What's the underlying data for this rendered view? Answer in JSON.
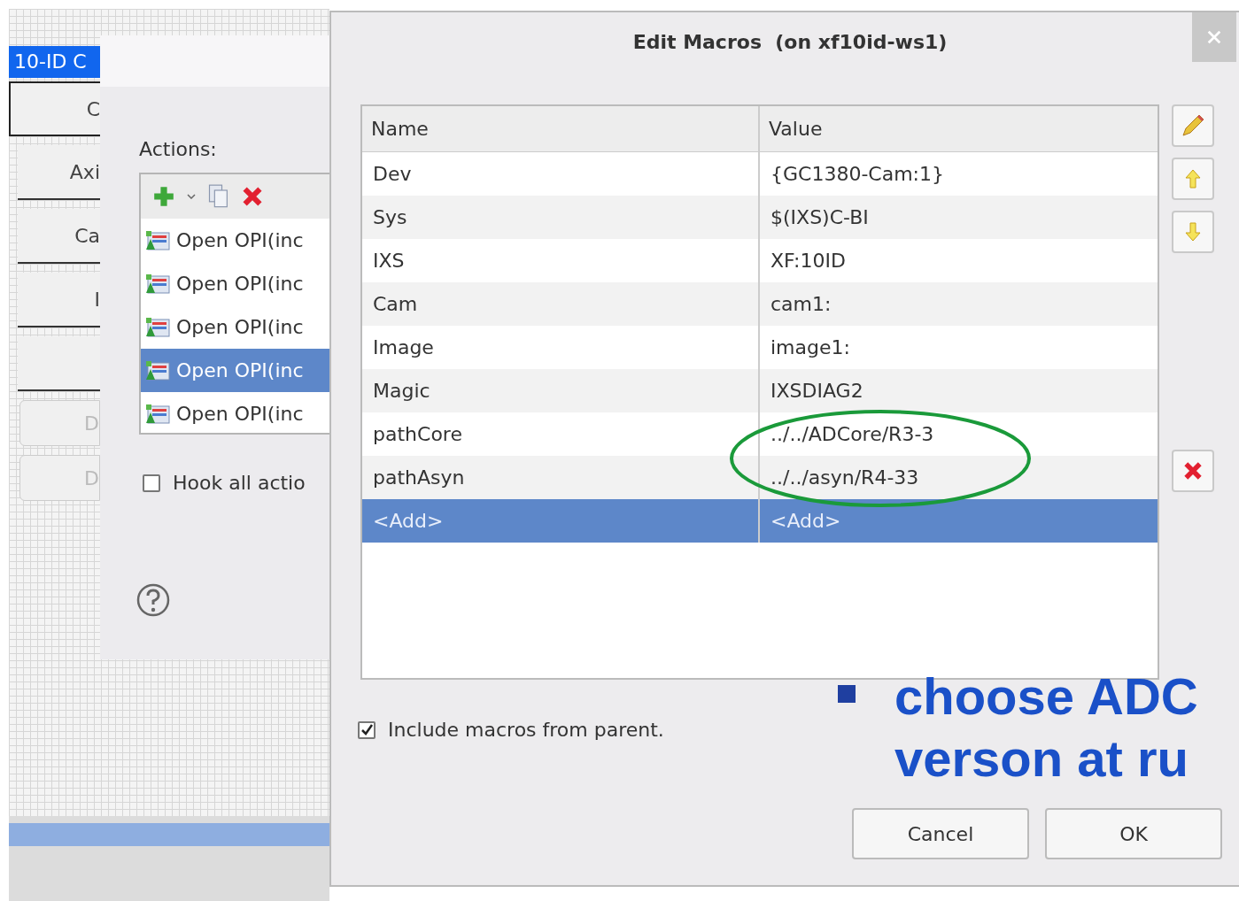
{
  "background_editor": {
    "title": "10-ID C",
    "widgets": [
      {
        "kind": "selected",
        "label": "C"
      },
      {
        "kind": "plain",
        "label": "Axi"
      },
      {
        "kind": "plain",
        "label": "Ca"
      },
      {
        "kind": "plain",
        "label": "I"
      },
      {
        "kind": "plain"
      },
      {
        "kind": "raised",
        "label": "D"
      },
      {
        "kind": "raised",
        "label": "D"
      }
    ]
  },
  "actions_dialog": {
    "actions_label": "Actions:",
    "actions": [
      {
        "label": "Open OPI(inc",
        "selected": false
      },
      {
        "label": "Open OPI(inc",
        "selected": false
      },
      {
        "label": "Open OPI(inc",
        "selected": false
      },
      {
        "label": "Open OPI(inc",
        "selected": true
      },
      {
        "label": "Open OPI(inc",
        "selected": false
      }
    ],
    "hook_all": {
      "label": "Hook all actio",
      "checked": false
    }
  },
  "edit_macros": {
    "title": "Edit Macros  (on xf10id-ws1)",
    "columns": [
      "Name",
      "Value"
    ],
    "rows": [
      {
        "name": "Dev",
        "value": "{GC1380-Cam:1}",
        "selected": false
      },
      {
        "name": "Sys",
        "value": "$(IXS)C-BI",
        "selected": false
      },
      {
        "name": "IXS",
        "value": "XF:10ID",
        "selected": false
      },
      {
        "name": "Cam",
        "value": "cam1:",
        "selected": false
      },
      {
        "name": "Image",
        "value": "image1:",
        "selected": false
      },
      {
        "name": "Magic",
        "value": "IXSDIAG2",
        "selected": false
      },
      {
        "name": "pathCore",
        "value": "../../ADCore/R3-3",
        "selected": false
      },
      {
        "name": "pathAsyn",
        "value": "../../asyn/R4-33",
        "selected": false
      },
      {
        "name": "<Add>",
        "value": "<Add>",
        "selected": true
      }
    ],
    "include_parent": {
      "label": "Include macros from parent.",
      "checked": true
    },
    "buttons": [
      "Cancel",
      "OK"
    ]
  },
  "slide_bullet": {
    "lines": [
      "choose ADC",
      "verson at ru"
    ]
  }
}
